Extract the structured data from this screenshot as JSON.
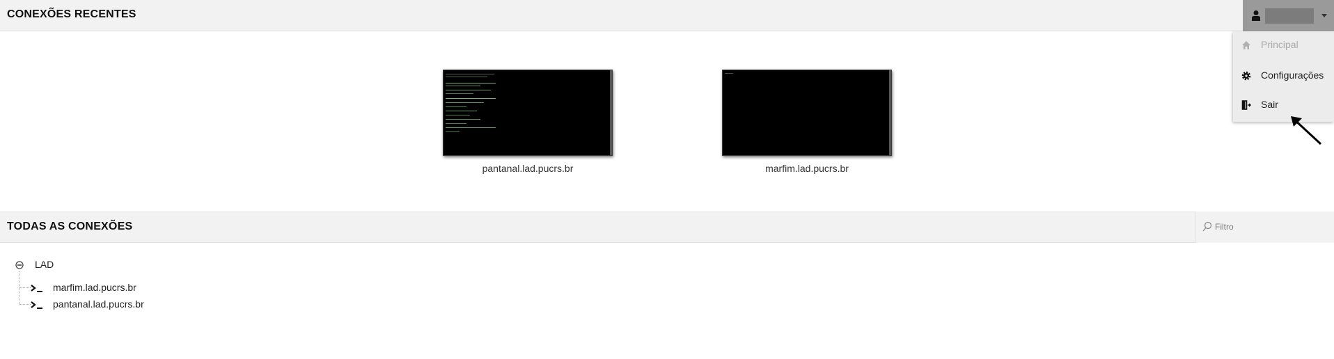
{
  "recent_section": {
    "title": "CONEXÕES RECENTES",
    "connections": [
      {
        "label": "pantanal.lad.pucrs.br"
      },
      {
        "label": "marfim.lad.pucrs.br"
      }
    ]
  },
  "all_section": {
    "title": "TODAS AS CONEXÕES",
    "filter_placeholder": "Filtro",
    "group": {
      "label": "LAD",
      "items": [
        {
          "label": "marfim.lad.pucrs.br"
        },
        {
          "label": "pantanal.lad.pucrs.br"
        }
      ]
    }
  },
  "user_menu": {
    "items": [
      {
        "label": "Principal",
        "icon": "home-icon",
        "disabled": true
      },
      {
        "label": "Configurações",
        "icon": "gear-icon",
        "disabled": false
      },
      {
        "label": "Sair",
        "icon": "logout-icon",
        "disabled": false
      }
    ]
  },
  "colors": {
    "header_bg": "#f2f2f2",
    "user_button_bg": "#9a9a9a",
    "dropdown_bg": "#ececec",
    "thumbnail_bg": "#000000",
    "terminal_text": "#7fb07f"
  }
}
